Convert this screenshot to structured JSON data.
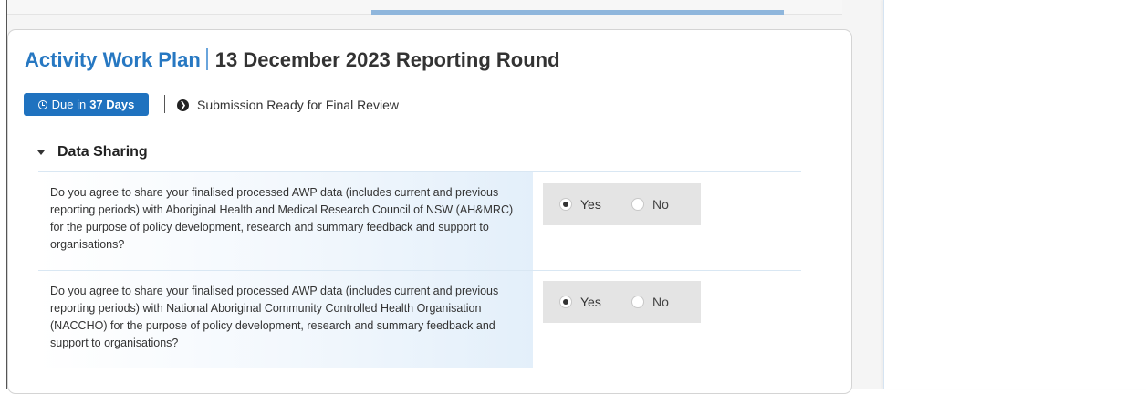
{
  "header": {
    "title_main": "Activity Work Plan",
    "title_sub": "13 December 2023 Reporting Round"
  },
  "status_bar": {
    "due_prefix": "Due in",
    "due_days": "37 Days",
    "status_text": "Submission Ready for Final Review",
    "clock_icon": "clock-icon",
    "status_icon": "circle-arrow-right-icon"
  },
  "section": {
    "title": "Data Sharing",
    "questions": [
      {
        "text": "Do you agree to share your finalised processed AWP data (includes current and previous reporting periods) with Aboriginal Health and Medical Research Council of NSW (AH&MRC) for the purpose of policy development, research and summary feedback and support to organisations?",
        "options": [
          "Yes",
          "No"
        ],
        "selected": "Yes"
      },
      {
        "text": "Do you agree to share your finalised processed AWP data (includes current and previous reporting periods) with National Aboriginal Community Controlled Health Organisation (NACCHO) for the purpose of policy development, research and summary feedback and support to organisations?",
        "options": [
          "Yes",
          "No"
        ],
        "selected": "Yes"
      }
    ]
  },
  "colors": {
    "accent": "#2778c2",
    "badge": "#1f72bf",
    "radio_group_bg": "#e4e4e4"
  }
}
